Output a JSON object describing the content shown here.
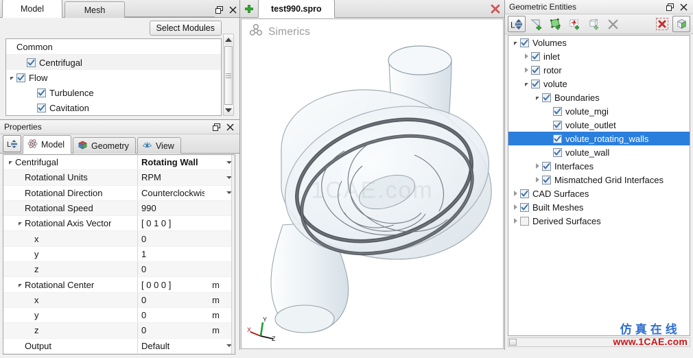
{
  "left": {
    "model_panel": {
      "tabs": [
        {
          "label": "Model",
          "active": true
        },
        {
          "label": "Mesh",
          "active": false
        }
      ],
      "select_modules_label": "Select Modules",
      "tree": [
        {
          "label": "Common",
          "indent": 0,
          "checkbox": "none",
          "expander": "none"
        },
        {
          "label": "Centrifugal",
          "indent": 1,
          "checkbox": "checked",
          "expander": "none"
        },
        {
          "label": "Flow",
          "indent": 0,
          "checkbox": "checked",
          "expander": "open"
        },
        {
          "label": "Turbulence",
          "indent": 2,
          "checkbox": "checked",
          "expander": "none"
        },
        {
          "label": "Cavitation",
          "indent": 2,
          "checkbox": "checked",
          "expander": "none"
        }
      ]
    },
    "properties_panel": {
      "title": "Properties",
      "tabs": [
        {
          "label": "Model",
          "icon": "atom-icon",
          "active": true
        },
        {
          "label": "Geometry",
          "icon": "cube-icon",
          "active": false
        },
        {
          "label": "View",
          "icon": "eye-icon",
          "active": false
        }
      ],
      "rows": [
        {
          "name": "Centrifugal",
          "indent": 0,
          "expander": "open",
          "value": "Rotating Wall",
          "unit": "",
          "caret": true,
          "bold": true
        },
        {
          "name": "Rotational Units",
          "indent": 1,
          "expander": "none",
          "value": "RPM",
          "unit": "",
          "caret": true,
          "bold": false
        },
        {
          "name": "Rotational Direction",
          "indent": 1,
          "expander": "none",
          "value": "Counterclockwise",
          "unit": "",
          "caret": true,
          "bold": false
        },
        {
          "name": "Rotational Speed",
          "indent": 1,
          "expander": "none",
          "value": "990",
          "unit": "",
          "caret": false,
          "bold": false
        },
        {
          "name": "Rotational Axis Vector",
          "indent": 1,
          "expander": "open",
          "value": "[ 0 1 0 ]",
          "unit": "",
          "caret": false,
          "bold": false
        },
        {
          "name": "x",
          "indent": 2,
          "expander": "none",
          "value": "0",
          "unit": "",
          "caret": false,
          "bold": false
        },
        {
          "name": "y",
          "indent": 2,
          "expander": "none",
          "value": "1",
          "unit": "",
          "caret": false,
          "bold": false
        },
        {
          "name": "z",
          "indent": 2,
          "expander": "none",
          "value": "0",
          "unit": "",
          "caret": false,
          "bold": false
        },
        {
          "name": "Rotational Center",
          "indent": 1,
          "expander": "open",
          "value": "[ 0 0 0 ]",
          "unit": "m",
          "caret": false,
          "bold": false
        },
        {
          "name": "x",
          "indent": 2,
          "expander": "none",
          "value": "0",
          "unit": "m",
          "caret": false,
          "bold": false
        },
        {
          "name": "y",
          "indent": 2,
          "expander": "none",
          "value": "0",
          "unit": "m",
          "caret": false,
          "bold": false
        },
        {
          "name": "z",
          "indent": 2,
          "expander": "none",
          "value": "0",
          "unit": "m",
          "caret": false,
          "bold": false
        },
        {
          "name": "Output",
          "indent": 1,
          "expander": "none",
          "value": "Default",
          "unit": "",
          "caret": true,
          "bold": false
        }
      ]
    }
  },
  "center": {
    "add_tab_icon": "plus-icon",
    "close_tab_icon": "close-document-icon",
    "document_tab": "test990.spro",
    "viewport": {
      "logo_text": "Simerics",
      "watermark": "1CAE.com",
      "axes": [
        {
          "label": "X",
          "color": "#b01818"
        },
        {
          "label": "Y",
          "color": "#1f9c3c"
        },
        {
          "label": "Z",
          "color": "#111111"
        }
      ]
    }
  },
  "right": {
    "title": "Geometric Entities",
    "toolbar": [
      {
        "icon": "fit-selection-icon",
        "selected": true
      },
      {
        "icon": "add-surface-icon",
        "selected": false
      },
      {
        "icon": "add-face-group-icon",
        "selected": false
      },
      {
        "icon": "add-boundary-icon",
        "selected": false
      },
      {
        "icon": "add-volume-icon",
        "selected": false
      },
      {
        "icon": "delete-icon",
        "selected": false
      },
      {
        "icon": "clear-selection-icon",
        "selected": false
      },
      {
        "icon": "show-solid-icon",
        "selected": true
      }
    ],
    "tree": [
      {
        "label": "Volumes",
        "indent": 0,
        "expander": "open",
        "checkbox": "checked",
        "selected": false
      },
      {
        "label": "inlet",
        "indent": 1,
        "expander": "closed",
        "checkbox": "checked",
        "selected": false
      },
      {
        "label": "rotor",
        "indent": 1,
        "expander": "closed",
        "checkbox": "checked",
        "selected": false
      },
      {
        "label": "volute",
        "indent": 1,
        "expander": "open",
        "checkbox": "checked",
        "selected": false
      },
      {
        "label": "Boundaries",
        "indent": 2,
        "expander": "open",
        "checkbox": "checked",
        "selected": false
      },
      {
        "label": "volute_mgi",
        "indent": 3,
        "expander": "none",
        "checkbox": "checked",
        "selected": false
      },
      {
        "label": "volute_outlet",
        "indent": 3,
        "expander": "none",
        "checkbox": "checked",
        "selected": false
      },
      {
        "label": "volute_rotating_walls",
        "indent": 3,
        "expander": "none",
        "checkbox": "checked",
        "selected": true
      },
      {
        "label": "volute_wall",
        "indent": 3,
        "expander": "none",
        "checkbox": "checked",
        "selected": false
      },
      {
        "label": "Interfaces",
        "indent": 2,
        "expander": "closed",
        "checkbox": "checked",
        "selected": false
      },
      {
        "label": "Mismatched Grid Interfaces",
        "indent": 2,
        "expander": "closed",
        "checkbox": "checked",
        "selected": false
      },
      {
        "label": "CAD Surfaces",
        "indent": 0,
        "expander": "closed",
        "checkbox": "checked",
        "selected": false
      },
      {
        "label": "Built Meshes",
        "indent": 0,
        "expander": "closed",
        "checkbox": "checked",
        "selected": false
      },
      {
        "label": "Derived Surfaces",
        "indent": 0,
        "expander": "closed",
        "checkbox": "unchecked",
        "selected": false
      }
    ],
    "watermark": {
      "cn": "仿真在线",
      "url": "www.1CAE.com"
    }
  },
  "colors": {
    "selection_blue": "#2a7fdc",
    "watermark_blue": "#2f6fd0",
    "watermark_red": "#d01414",
    "panel_bg": "#f0f0f0"
  }
}
